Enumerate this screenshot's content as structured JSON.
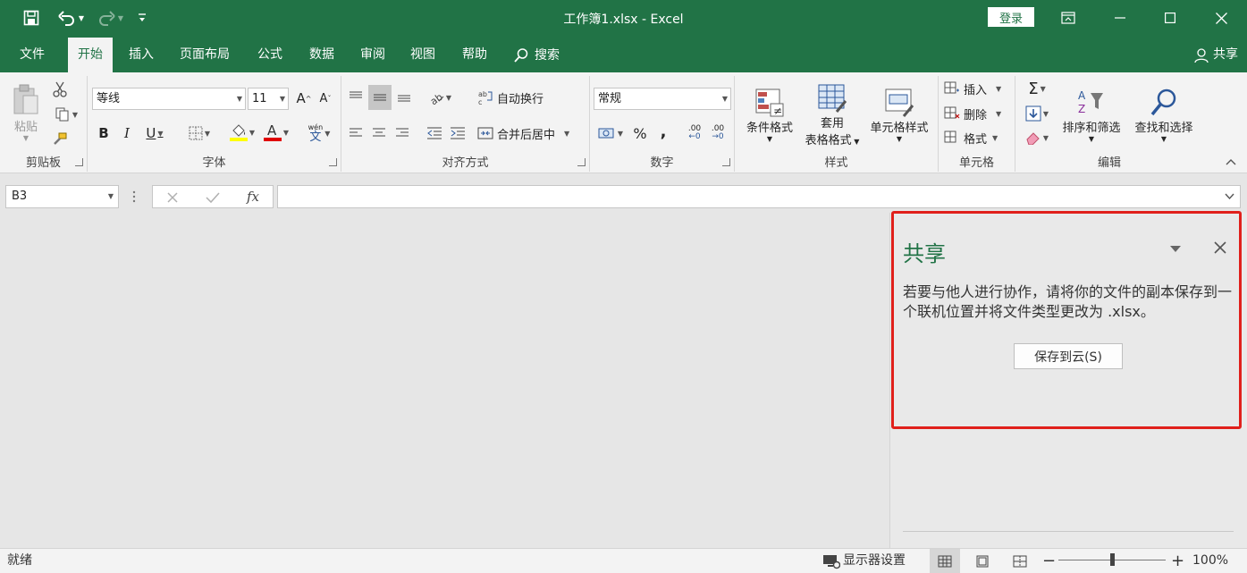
{
  "window": {
    "title": "工作簿1.xlsx  -  Excel",
    "login": "登录"
  },
  "tabs": [
    "文件",
    "开始",
    "插入",
    "页面布局",
    "公式",
    "数据",
    "审阅",
    "视图",
    "帮助"
  ],
  "search_label": "搜索",
  "share_label": "共享",
  "ribbon": {
    "clipboard": {
      "paste": "粘贴",
      "label": "剪贴板"
    },
    "font": {
      "name": "等线",
      "size": "11",
      "label": "字体",
      "wen": "wén",
      "wen_char": "文"
    },
    "align": {
      "wrap": "自动换行",
      "merge": "合并后居中",
      "label": "对齐方式"
    },
    "number": {
      "format": "常规",
      "percent": "%",
      "comma": ",",
      "dec_inc": ".00",
      "dec_dec": ".00",
      "label": "数字"
    },
    "styles": {
      "conditional": "条件格式",
      "table_a": "套用",
      "table_b": "表格格式",
      "cell": "单元格样式",
      "label": "样式"
    },
    "cells": {
      "insert": "插入",
      "delete": "删除",
      "format": "格式",
      "label": "单元格"
    },
    "edit": {
      "sort": "排序和筛选",
      "find": "查找和选择",
      "label": "编辑"
    }
  },
  "formula_bar": {
    "cell": "B3",
    "fx": "fx",
    "value": ""
  },
  "share_panel": {
    "title": "共享",
    "message": "若要与他人进行协作，请将你的文件的副本保存到一个联机位置并将文件类型更改为 .xlsx。",
    "button": "保存到云(S)"
  },
  "status": {
    "ready": "就绪",
    "display": "显示器设置",
    "zoom": "100%"
  },
  "colors": {
    "brand": "#217346",
    "highlight": "#e0201b"
  }
}
